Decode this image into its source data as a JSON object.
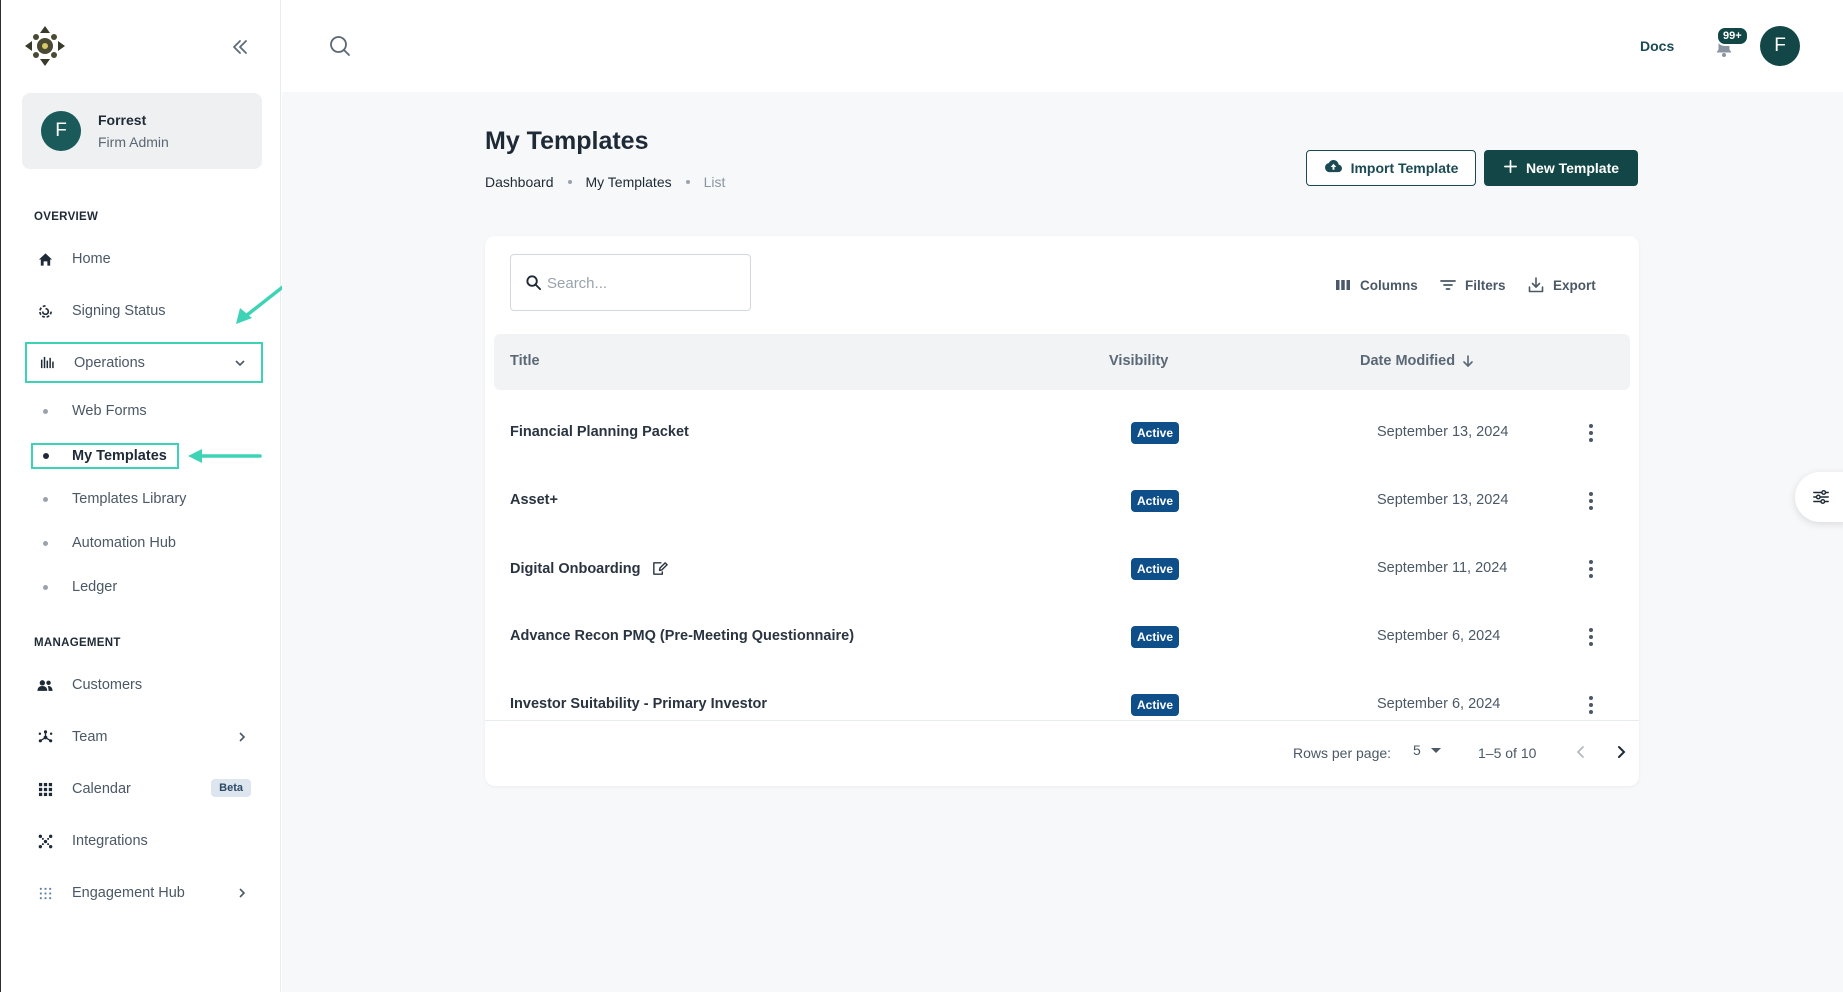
{
  "sidebar": {
    "user": {
      "initial": "F",
      "name": "Forrest",
      "role": "Firm Admin"
    },
    "sections": {
      "overview": "OVERVIEW",
      "management": "MANAGEMENT"
    },
    "overview_items": [
      {
        "label": "Home",
        "icon": "home-icon"
      },
      {
        "label": "Signing Status",
        "icon": "signing-status-icon"
      },
      {
        "label": "Operations",
        "icon": "operations-icon"
      }
    ],
    "operations_subitems": [
      {
        "label": "Web Forms"
      },
      {
        "label": "My Templates"
      },
      {
        "label": "Templates Library"
      },
      {
        "label": "Automation Hub"
      },
      {
        "label": "Ledger"
      }
    ],
    "management_items": [
      {
        "label": "Customers",
        "icon": "customers-icon"
      },
      {
        "label": "Team",
        "icon": "team-icon"
      },
      {
        "label": "Calendar",
        "icon": "calendar-icon",
        "badge": "Beta"
      },
      {
        "label": "Integrations",
        "icon": "integrations-icon"
      },
      {
        "label": "Engagement Hub",
        "icon": "engagement-hub-icon"
      }
    ]
  },
  "topbar": {
    "docs": "Docs",
    "notifications_badge": "99+",
    "avatar_initial": "F"
  },
  "page": {
    "title": "My Templates",
    "breadcrumb": [
      "Dashboard",
      "My Templates",
      "List"
    ],
    "import_button": "Import Template",
    "new_button": "New Template"
  },
  "table": {
    "search_placeholder": "Search...",
    "toolbar": {
      "columns": "Columns",
      "filters": "Filters",
      "export": "Export"
    },
    "headers": {
      "title": "Title",
      "visibility": "Visibility",
      "date_modified": "Date Modified"
    },
    "rows": [
      {
        "title": "Financial Planning Packet",
        "visibility": "Active",
        "date": "September 13, 2024"
      },
      {
        "title": "Asset+",
        "visibility": "Active",
        "date": "September 13, 2024"
      },
      {
        "title": "Digital Onboarding",
        "visibility": "Active",
        "date": "September 11, 2024",
        "icon": "edit-doc-icon"
      },
      {
        "title": "Advance Recon PMQ (Pre-Meeting Questionnaire)",
        "visibility": "Active",
        "date": "September 6, 2024"
      },
      {
        "title": "Investor Suitability - Primary Investor",
        "visibility": "Active",
        "date": "September 6, 2024"
      }
    ],
    "footer": {
      "rows_per_page_label": "Rows per page:",
      "rows_per_page": "5",
      "range": "1–5 of 10"
    }
  },
  "colors": {
    "brand": "#134747",
    "active_badge": "#0e4f8a",
    "annotation": "#3fd3b6"
  }
}
